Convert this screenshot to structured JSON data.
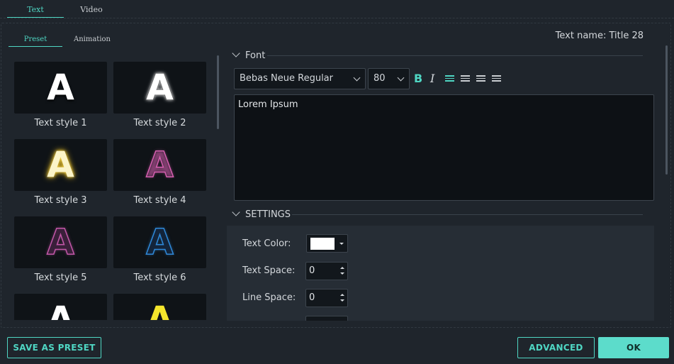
{
  "top_tabs": [
    {
      "label": "Text",
      "active": true
    },
    {
      "label": "Video",
      "active": false
    }
  ],
  "sub_tabs": [
    {
      "label": "Preset",
      "active": true
    },
    {
      "label": "Animation",
      "active": false
    }
  ],
  "text_name": "Text name: Title 28",
  "presets": [
    {
      "glyph": "A",
      "label": "Text style 1"
    },
    {
      "glyph": "A",
      "label": "Text style 2"
    },
    {
      "glyph": "A",
      "label": "Text style 3"
    },
    {
      "glyph": "A",
      "label": "Text style 4"
    },
    {
      "glyph": "A",
      "label": "Text style 5"
    },
    {
      "glyph": "A",
      "label": "Text style 6"
    },
    {
      "glyph": "A",
      "label": ""
    },
    {
      "glyph": "A",
      "label": ""
    }
  ],
  "font_section": {
    "title": "Font",
    "font_family": "Bebas Neue Regular",
    "font_size": "80",
    "bold_label": "B",
    "italic_label": "I",
    "text_content": "Lorem Ipsum"
  },
  "settings_section": {
    "title": "SETTINGS",
    "text_color_label": "Text Color:",
    "text_color": "#ffffff",
    "text_space_label": "Text Space:",
    "text_space_value": "0",
    "line_space_label": "Line Space:",
    "line_space_value": "0"
  },
  "buttons": {
    "save_preset": "SAVE AS PRESET",
    "advanced": "ADVANCED",
    "ok": "OK"
  },
  "colors": {
    "accent": "#4fd6c3",
    "background": "#1f252c"
  }
}
